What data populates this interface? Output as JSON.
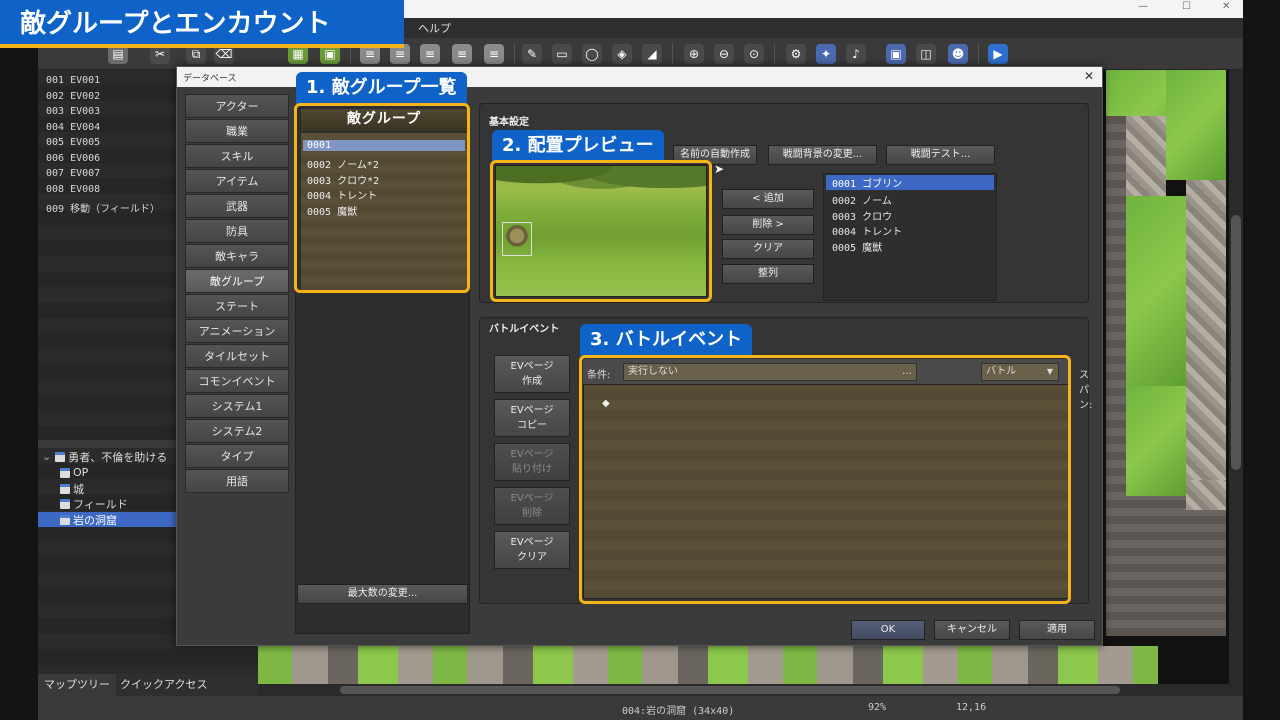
{
  "window": {
    "menu_help": "ヘルプ"
  },
  "event_list": [
    "001 EV001",
    "002 EV002",
    "003 EV003",
    "004 EV004",
    "005 EV005",
    "006 EV006",
    "007 EV007",
    "008 EV008",
    "009 移動（フィールド）"
  ],
  "map_tree": {
    "root": "勇者、不倫を助ける",
    "items": [
      "OP",
      "城",
      "フィールド",
      "岩の洞窟"
    ],
    "selected": "岩の洞窟"
  },
  "bottom_tabs": [
    "マップツリー",
    "クイックアクセス"
  ],
  "status_bar": {
    "map": "004:岩の洞窟 (34x40)",
    "zoom": "92%",
    "coords": "12,16"
  },
  "dialog": {
    "title": "データベース",
    "categories": [
      "アクター",
      "職業",
      "スキル",
      "アイテム",
      "武器",
      "防具",
      "敵キャラ",
      "敵グループ",
      "ステート",
      "アニメーション",
      "タイルセット",
      "コモンイベント",
      "システム1",
      "システム2",
      "タイプ",
      "用語"
    ],
    "selected_category": "敵グループ",
    "groups_title": "敵グループ",
    "groups": [
      "0001",
      "0002 ノーム*2",
      "0003 クロウ*2",
      "0004 トレント",
      "0005 魔獣"
    ],
    "max_button": "最大数の変更...",
    "basic": {
      "label": "基本設定",
      "auto_name": "名前の自動作成",
      "change_bg": "戦闘背景の変更...",
      "battle_test": "戦闘テスト...",
      "add": "< 追加",
      "remove": "削除 >",
      "clear": "クリア",
      "align": "整列",
      "enemies": [
        "0001 ゴブリン",
        "0002 ノーム",
        "0003 クロウ",
        "0004 トレント",
        "0005 魔獣"
      ]
    },
    "battle_event": {
      "label": "バトルイベント",
      "buttons": [
        "EVページ\n作成",
        "EVページ\nコピー",
        "EVページ\n貼り付け",
        "EVページ\n削除",
        "EVページ\nクリア"
      ],
      "condition_label": "条件:",
      "condition_value": "実行しない",
      "span_label": "スパン:",
      "span_value": "バトル"
    },
    "footer": {
      "ok": "OK",
      "cancel": "キャンセル",
      "apply": "適用"
    }
  },
  "overlay": {
    "title": "敵グループとエンカウント",
    "callouts": [
      "1. 敵グループ一覧",
      "2. 配置プレビュー",
      "3. バトルイベント"
    ],
    "accent": "#f5b418",
    "brand": "#0e62c8"
  }
}
